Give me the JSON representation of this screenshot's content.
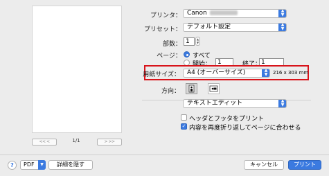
{
  "preview": {
    "page_indicator": "1/1",
    "first_label": "<<",
    "prev_label": "<",
    "next_label": ">",
    "last_label": ">>"
  },
  "printer": {
    "label": "プリンタ：",
    "value": "Canon"
  },
  "preset": {
    "label": "プリセット：",
    "value": "デフォルト設定"
  },
  "copies": {
    "label": "部数：",
    "value": "1"
  },
  "pages": {
    "label": "ページ：",
    "all_label": "すべて",
    "from_label": "開始：",
    "from_value": "1",
    "to_label": "終了：",
    "to_value": "1"
  },
  "paper_size": {
    "label": "用紙サイズ：",
    "value": "A4 (オーバーサイズ)",
    "dimensions": "216 x 303 mm"
  },
  "orientation": {
    "label": "方向："
  },
  "app_section": {
    "value": "テキストエディット"
  },
  "options": {
    "header_footer": {
      "label": "ヘッダとフッタをプリント",
      "checked": false
    },
    "rewrap": {
      "label": "内容を再度折り返してページに合わせる",
      "checked": true
    }
  },
  "footer": {
    "help_label": "?",
    "pdf_label": "PDF",
    "hide_details_label": "詳細を隠す",
    "cancel_label": "キャンセル",
    "print_label": "プリント"
  },
  "colors": {
    "accent": "#3b7ae0",
    "highlight_border": "#d8131a"
  }
}
